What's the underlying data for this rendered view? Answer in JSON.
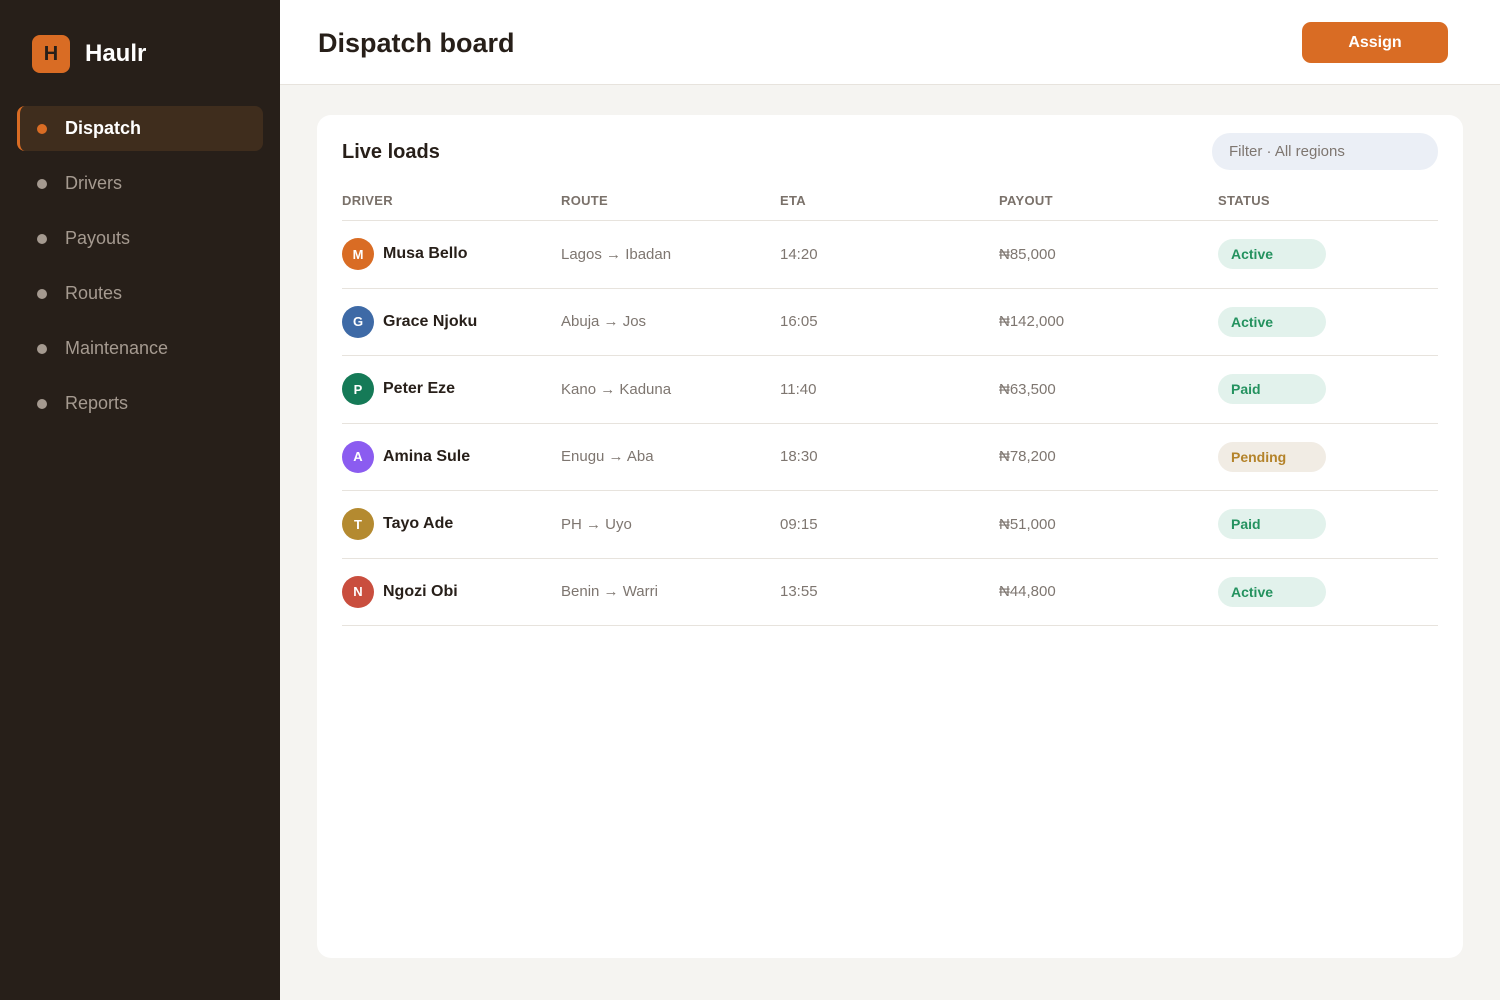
{
  "app": {
    "logo_letter": "H",
    "name": "Haulr"
  },
  "sidebar": {
    "items": [
      {
        "label": "Dispatch",
        "active": true
      },
      {
        "label": "Drivers",
        "active": false
      },
      {
        "label": "Payouts",
        "active": false
      },
      {
        "label": "Routes",
        "active": false
      },
      {
        "label": "Maintenance",
        "active": false
      },
      {
        "label": "Reports",
        "active": false
      }
    ]
  },
  "header": {
    "title": "Dispatch board",
    "assign_label": "Assign"
  },
  "loads": {
    "title": "Live loads",
    "filter_placeholder": "Filter · All regions",
    "columns": [
      "DRIVER",
      "ROUTE",
      "ETA",
      "PAYOUT",
      "STATUS"
    ],
    "rows": [
      {
        "initial": "M",
        "avatar_color": "#d96c24",
        "driver": "Musa Bello",
        "route": "Lagos → Ibadan",
        "eta": "14:20",
        "payout": "₦85,000",
        "status": "Active"
      },
      {
        "initial": "G",
        "avatar_color": "#3e6aa6",
        "driver": "Grace Njoku",
        "route": "Abuja → Jos",
        "eta": "16:05",
        "payout": "₦142,000",
        "status": "Active"
      },
      {
        "initial": "P",
        "avatar_color": "#157a57",
        "driver": "Peter Eze",
        "route": "Kano → Kaduna",
        "eta": "11:40",
        "payout": "₦63,500",
        "status": "Paid"
      },
      {
        "initial": "A",
        "avatar_color": "#8b5cf0",
        "driver": "Amina Sule",
        "route": "Enugu → Aba",
        "eta": "18:30",
        "payout": "₦78,200",
        "status": "Pending"
      },
      {
        "initial": "T",
        "avatar_color": "#b48a30",
        "driver": "Tayo Ade",
        "route": "PH → Uyo",
        "eta": "09:15",
        "payout": "₦51,000",
        "status": "Paid"
      },
      {
        "initial": "N",
        "avatar_color": "#c94e3e",
        "driver": "Ngozi Obi",
        "route": "Benin → Warri",
        "eta": "13:55",
        "payout": "₦44,800",
        "status": "Active"
      }
    ]
  },
  "colors": {
    "accent": "#d96c24",
    "sidebar_bg": "#271f19",
    "status_green": "#24925f",
    "status_amber": "#b4832a"
  }
}
